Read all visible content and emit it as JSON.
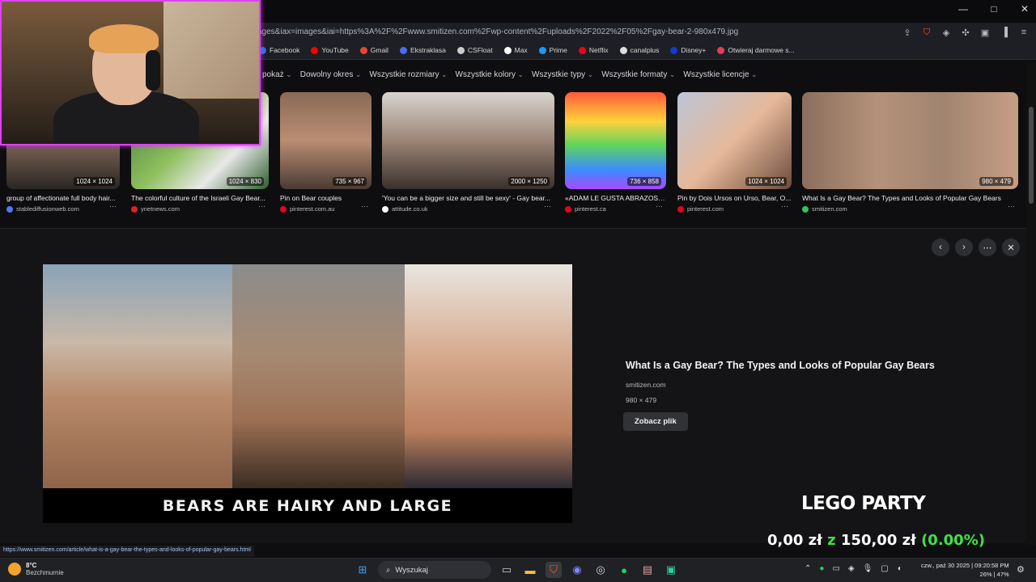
{
  "window": {
    "minimize": "—",
    "maximize": "□",
    "close": "✕"
  },
  "address_bar": {
    "url": "ages&iax=images&iai=https%3A%2F%2Fwww.smitizen.com%2Fwp-content%2Fuploads%2F2022%2F05%2Fgay-bear-2-980x479.jpg"
  },
  "bookmarks": [
    {
      "label": "Facebook",
      "color": "#1877f2"
    },
    {
      "label": "YouTube",
      "color": "#ff0000"
    },
    {
      "label": "Gmail",
      "color": "#ea4335"
    },
    {
      "label": "Ekstraklasa",
      "color": "#4a6cf7"
    },
    {
      "label": "CSFloat",
      "color": "#cccccc"
    },
    {
      "label": "Max",
      "color": "#ffffff"
    },
    {
      "label": "Prime",
      "color": "#1a98ff"
    },
    {
      "label": "Netflix",
      "color": "#e50914"
    },
    {
      "label": "canalplus",
      "color": "#dddddd"
    },
    {
      "label": "Disney+",
      "color": "#113ccf"
    },
    {
      "label": "Otwieraj darmowe s...",
      "color": "#e63b5a"
    }
  ],
  "filters": [
    "pokaż",
    "Dowolny okres",
    "Wszystkie rozmiary",
    "Wszystkie kolory",
    "Wszystkie typy",
    "Wszystkie formaty",
    "Wszystkie licencje"
  ],
  "thumbnails": [
    {
      "caption": "group of affectionate full body hair...",
      "source": "stablediffusionweb.com",
      "dims": "1024 × 1024",
      "fav": "#4a7cf0"
    },
    {
      "caption": "The colorful culture of the Israeli Gay Bear...",
      "source": "ynetnews.com",
      "dims": "1024 × 830",
      "fav": "#e0202c"
    },
    {
      "caption": "Pin on Bear couples",
      "source": "pinterest.com.au",
      "dims": "735 × 967",
      "fav": "#e60023"
    },
    {
      "caption": "'You can be a bigger size and still be sexy' - Gay bear...",
      "source": "attitude.co.uk",
      "dims": "2000 × 1250",
      "fav": "#ffffff"
    },
    {
      "caption": "«ADAM LE GUSTA ABRAZOS -...",
      "source": "pinterest.ca",
      "dims": "736 × 858",
      "fav": "#e60023"
    },
    {
      "caption": "Pin by Dois Ursos on Urso, Bear, O...",
      "source": "pinterest.com",
      "dims": "1024 × 1024",
      "fav": "#e60023"
    },
    {
      "caption": "What Is a Gay Bear? The Types and Looks of Popular Gay Bears",
      "source": "smitizen.com",
      "dims": "980 × 479",
      "fav": "#36c25a"
    }
  ],
  "detail": {
    "banner_text": "BEARS ARE HAIRY AND LARGE",
    "title": "What Is a Gay Bear? The Types and Looks of Popular Gay Bears",
    "site": "smitizen.com",
    "size": "980 × 479",
    "button": "Zobacz plik"
  },
  "overlay": {
    "game": "LEGO PARTY",
    "amount": "0,00 zł",
    "z": "z",
    "goal": "150,00 zł",
    "percent": "(0.00%)"
  },
  "status_url": "https://www.smitizen.com/article/what-is-a-gay-bear-the-types-and-looks-of-popular-gay-bears.html",
  "taskbar": {
    "temp": "8°C",
    "condition": "Bezchmurnie",
    "search": "Wyszukaj",
    "date": "czw., paź 30 2025 | 09:20:58 PM",
    "battery": "26% | 47%"
  }
}
